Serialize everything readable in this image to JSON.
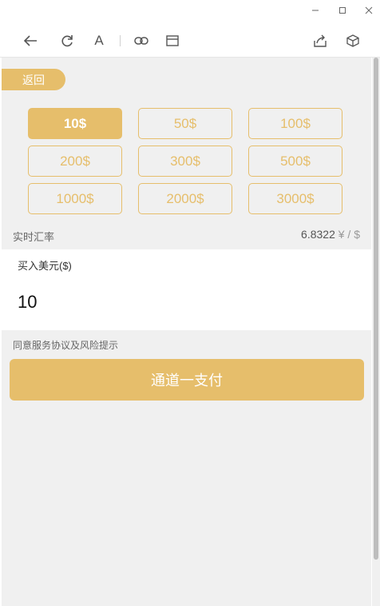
{
  "window": {
    "controls": [
      {
        "name": "minimize-icon"
      },
      {
        "name": "maximize-icon"
      },
      {
        "name": "close-icon"
      }
    ]
  },
  "toolbar": {
    "icons": [
      "back-arrow-icon",
      "refresh-icon",
      "font-icon",
      "link-icon",
      "window-icon",
      "share-icon",
      "cube-icon"
    ],
    "font_glyph": "A"
  },
  "page": {
    "back_label": "返回",
    "amounts": [
      "10$",
      "50$",
      "100$",
      "200$",
      "300$",
      "500$",
      "1000$",
      "2000$",
      "3000$"
    ],
    "selected_amount": "10$",
    "rate_label": "实时汇率",
    "rate_value": "6.8322",
    "rate_unit": "¥ / $",
    "buy_label": "买入美元($)",
    "buy_value": "10",
    "agreement_text": "同意服务协议及风险提示",
    "pay_button_label": "通道一支付"
  },
  "colors": {
    "accent": "#e6be6b",
    "background": "#f0f0f0"
  }
}
